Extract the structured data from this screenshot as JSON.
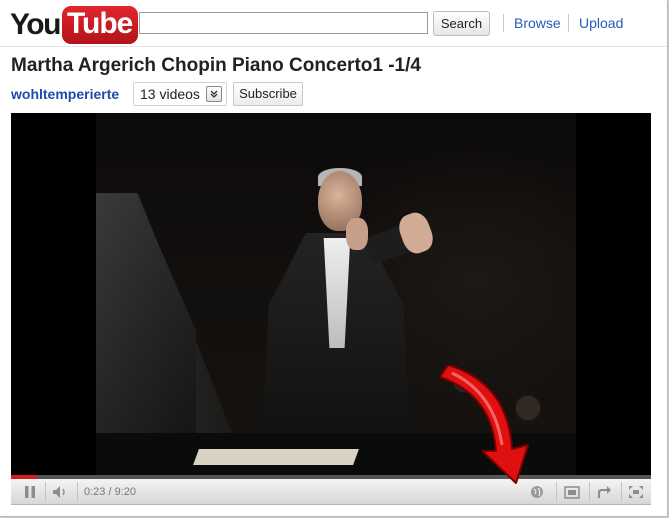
{
  "header": {
    "logo": {
      "you": "You",
      "tube": "Tube"
    },
    "search": {
      "value": "",
      "button_label": "Search"
    },
    "nav": {
      "browse": "Browse",
      "upload": "Upload"
    }
  },
  "video": {
    "title": "Martha Argerich Chopin Piano Concerto1 -1/4",
    "channel": "wohltemperierte",
    "videos_count": "13 videos",
    "subscribe_label": "Subscribe"
  },
  "player": {
    "current_time": "0:23",
    "duration": "9:20",
    "time_display": "0:23 / 9:20",
    "progress_fraction": 0.041,
    "icons": [
      "pause-icon",
      "volume-icon",
      "globe-icon",
      "popout-icon",
      "share-icon",
      "fullscreen-icon"
    ]
  },
  "colors": {
    "brand_red": "#cc181e",
    "link_blue": "#1f4cab",
    "annotation_arrow": "#e01010"
  }
}
